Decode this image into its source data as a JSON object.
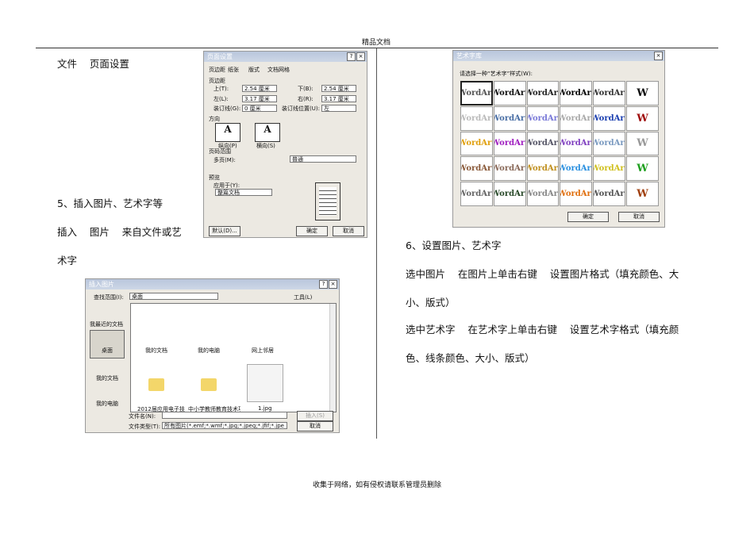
{
  "header": {
    "title": "精品文档"
  },
  "footer": {
    "text": "收集于网络，如有侵权请联系管理员删除"
  },
  "left": {
    "line1": "文件    页面设置",
    "line2": "5、插入图片、艺术字等",
    "line3": "插入    图片    来自文件或艺",
    "line4": "术字"
  },
  "right": {
    "line1": "6、设置图片、艺术字",
    "line2": "选中图片    在图片上单击右键    设置图片格式（填充颜色、大",
    "line3": "小、版式）",
    "line4": "选中艺术字    在艺术字上单击右键    设置艺术字格式（填充颜",
    "line5": "色、线条颜色、大小、版式）"
  },
  "page_setup": {
    "title": "页面设置",
    "tabs": [
      "页边距",
      "纸张",
      "版式",
      "文档网格"
    ],
    "margins_label": "页边距",
    "top_label": "上(T):",
    "top": "2.54 厘米",
    "bottom_label": "下(B):",
    "bottom": "2.54 厘米",
    "left_label": "左(L):",
    "left": "3.17 厘米",
    "right_label": "右(R):",
    "right": "3.17 厘米",
    "gutter_label": "装订线(G):",
    "gutter": "0 厘米",
    "gutter_pos_label": "装订线位置(U):",
    "gutter_pos": "左",
    "orientation_label": "方向",
    "portrait": "纵向(P)",
    "landscape": "横向(S)",
    "pages_label": "页码范围",
    "multi_label": "多页(M):",
    "multi": "普通",
    "preview_label": "预览",
    "apply_label": "应用于(Y):",
    "apply": "整篇文档",
    "default_btn": "默认(D)...",
    "ok": "确定",
    "cancel": "取消"
  },
  "insert_picture": {
    "title": "插入图片",
    "lookin_label": "查找范围(I):",
    "lookin": "桌面",
    "tools": "工具(L)",
    "places": [
      "我最近的文档",
      "桌面",
      "我的文档",
      "我的电脑"
    ],
    "files": [
      "我的文档",
      "我的电脑",
      "网上邻居",
      "2012届应用电子技",
      "中小学教师教育技术项",
      "1.jpg"
    ],
    "filename_label": "文件名(N):",
    "filename": "",
    "filetype_label": "文件类型(T):",
    "filetype": "所有图片(*.emf;*.wmf;*.jpg;*.jpeg;*.jfif;*.jpe",
    "insert_btn": "插入(S)",
    "cancel": "取消"
  },
  "wordart": {
    "title": "艺术字库",
    "prompt": "请选择一种“艺术字”样式(W):",
    "sample": "WordArt",
    "vsample": "W",
    "colors": [
      "#555",
      "#111",
      "#222",
      "#000",
      "#333",
      "#111",
      "#bbb",
      "#4a6fa5",
      "#7a7ad8",
      "#aaa",
      "#1b3fb0",
      "#a01010",
      "#e0a010",
      "#a020c0",
      "#556",
      "#8040c0",
      "#7a9ac0",
      "#999",
      "#8a5a3a",
      "#8a6a5a",
      "#c09020",
      "#2a90e0",
      "#d0c020",
      "#20a020",
      "#666",
      "#2a4a2a",
      "#888",
      "#e07010",
      "#555",
      "#a04010"
    ],
    "ok": "确定",
    "cancel": "取消"
  }
}
